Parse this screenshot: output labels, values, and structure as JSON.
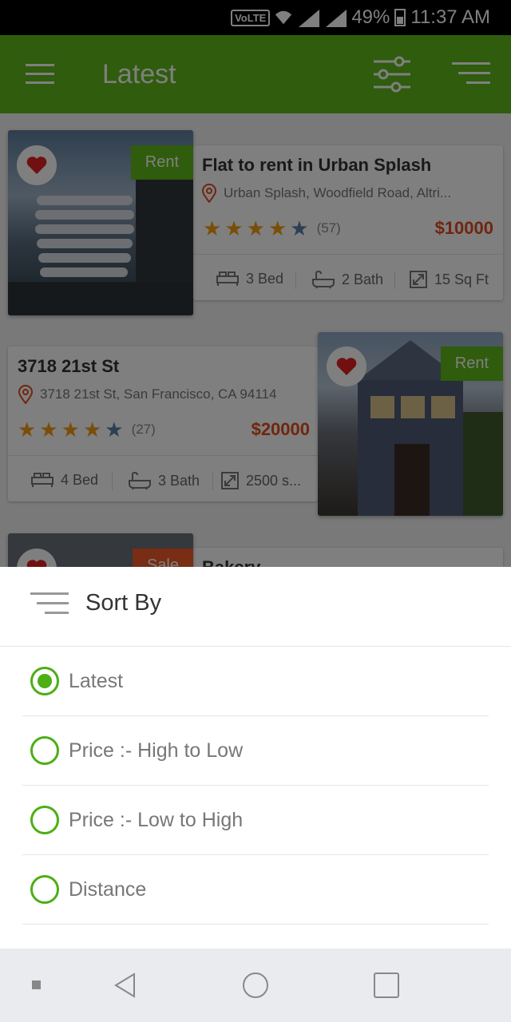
{
  "status_bar": {
    "volte": "VoLTE",
    "battery": "49%",
    "time": "11:37 AM",
    "sim1": "1",
    "sim2": "2"
  },
  "app_bar": {
    "title": "Latest",
    "color": "#5eb81b",
    "icons": [
      "menu-icon",
      "filter-sliders-icon",
      "sort-icon"
    ]
  },
  "listings": [
    {
      "title": "Flat to rent in Urban Splash",
      "badge": "Rent",
      "address": "Urban Splash, Woodfield Road, Altri...",
      "rating": 4,
      "reviews": "(57)",
      "price": "$10000",
      "beds": "3 Bed",
      "baths": "2 Bath",
      "area": "15 Sq Ft"
    },
    {
      "title": "3718 21st St",
      "badge": "Rent",
      "address": "3718 21st St, San Francisco, CA 94114",
      "rating": 4,
      "reviews": "(27)",
      "price": "$20000",
      "beds": "4 Bed",
      "baths": "3 Bath",
      "area": "2500 s..."
    },
    {
      "title": "Bakery",
      "badge": "Sale"
    }
  ],
  "sort_sheet": {
    "title": "Sort By",
    "options": [
      "Latest",
      "Price :- High to Low",
      "Price :- Low to High",
      "Distance"
    ],
    "selected": "Latest",
    "accent": "#4caf14"
  },
  "colors": {
    "price": "#e24a1d",
    "star_filled": "#f39c12",
    "star_empty": "#5b7fa8",
    "badge_rent": "#5eb81b",
    "badge_sale": "#f05a28",
    "heart": "#e02020"
  }
}
